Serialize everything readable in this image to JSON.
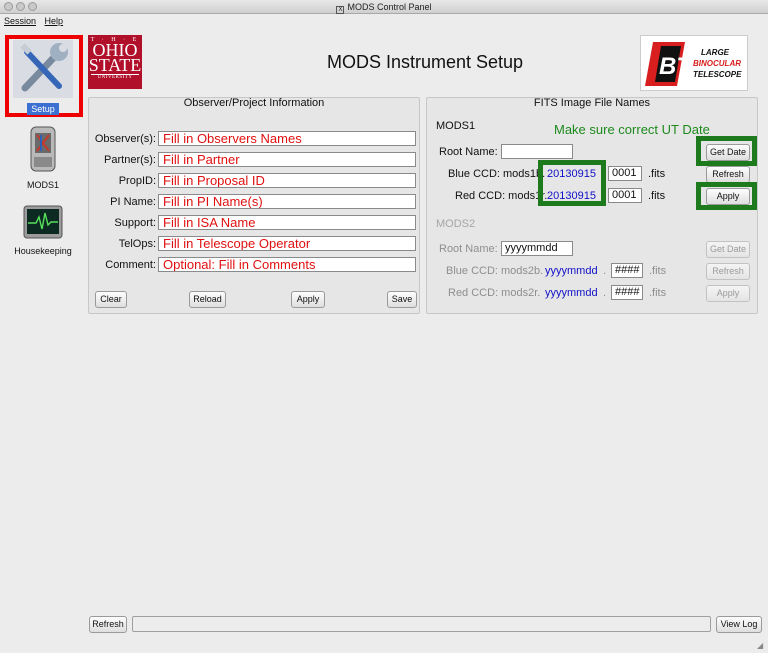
{
  "window": {
    "title": "MODS Control Panel"
  },
  "menu": {
    "session": "Session",
    "help": "Help"
  },
  "sidebar": {
    "items": [
      {
        "label": "Setup",
        "icon": "setup-tools-icon",
        "selected": true
      },
      {
        "label": "MODS1",
        "icon": "mods1-instrument-icon"
      },
      {
        "label": "Housekeeping",
        "icon": "housekeeping-monitor-icon"
      }
    ]
  },
  "header": {
    "title": "MODS Instrument Setup",
    "osu_logo": {
      "line1": "T · H · E",
      "line2a": "OHIO",
      "line2b": "STATE",
      "line3": "UNIVERSITY"
    },
    "lbt_logo": {
      "mark": "BT",
      "line1": "LARGE",
      "line2": "BINOCULAR",
      "line3": "TELESCOPE"
    }
  },
  "observer_panel": {
    "title": "Observer/Project Information",
    "rows": [
      {
        "label": "Observer(s):",
        "value": "Fill in Observers Names"
      },
      {
        "label": "Partner(s):",
        "value": "Fill in Partner"
      },
      {
        "label": "PropID:",
        "value": "Fill in Proposal ID"
      },
      {
        "label": "PI Name:",
        "value": "Fill in PI Name(s)"
      },
      {
        "label": "Support:",
        "value": "Fill in ISA Name"
      },
      {
        "label": "TelOps:",
        "value": "Fill in Telescope Operator"
      },
      {
        "label": "Comment:",
        "value": "Optional:  Fill in Comments"
      }
    ],
    "buttons": {
      "clear": "Clear",
      "reload": "Reload",
      "apply": "Apply",
      "save": "Save"
    }
  },
  "fits_panel": {
    "title": "FITS Image File Names",
    "mods1": {
      "label": "MODS1",
      "note": "Make sure correct UT Date",
      "root_label": "Root Name:",
      "root_value": "",
      "blue_label": "Blue CCD: mods1b.",
      "blue_date": "20130915",
      "blue_num": "0001",
      "red_label": "Red CCD: mods1r.",
      "red_date": "20130915",
      "red_num": "0001",
      "ext": ".fits",
      "buttons": {
        "get_date": "Get Date",
        "refresh": "Refresh",
        "apply": "Apply"
      }
    },
    "mods2": {
      "label": "MODS2",
      "root_label": "Root Name:",
      "root_value": "yyyymmdd",
      "blue_label": "Blue CCD: mods2b.",
      "blue_date": "yyyymmdd",
      "blue_num": "####",
      "red_label": "Red CCD: mods2r.",
      "red_date": "yyyymmdd",
      "red_num": "####",
      "sep": ".",
      "ext": ".fits",
      "buttons": {
        "get_date": "Get Date",
        "refresh": "Refresh",
        "apply": "Apply"
      }
    }
  },
  "footer": {
    "refresh": "Refresh",
    "view_log": "View Log",
    "status": ""
  },
  "colors": {
    "highlight_red": "#ee0000",
    "annotation_green": "#1d7a1d",
    "field_text_red": "#e01010",
    "date_blue": "#1010c8"
  }
}
